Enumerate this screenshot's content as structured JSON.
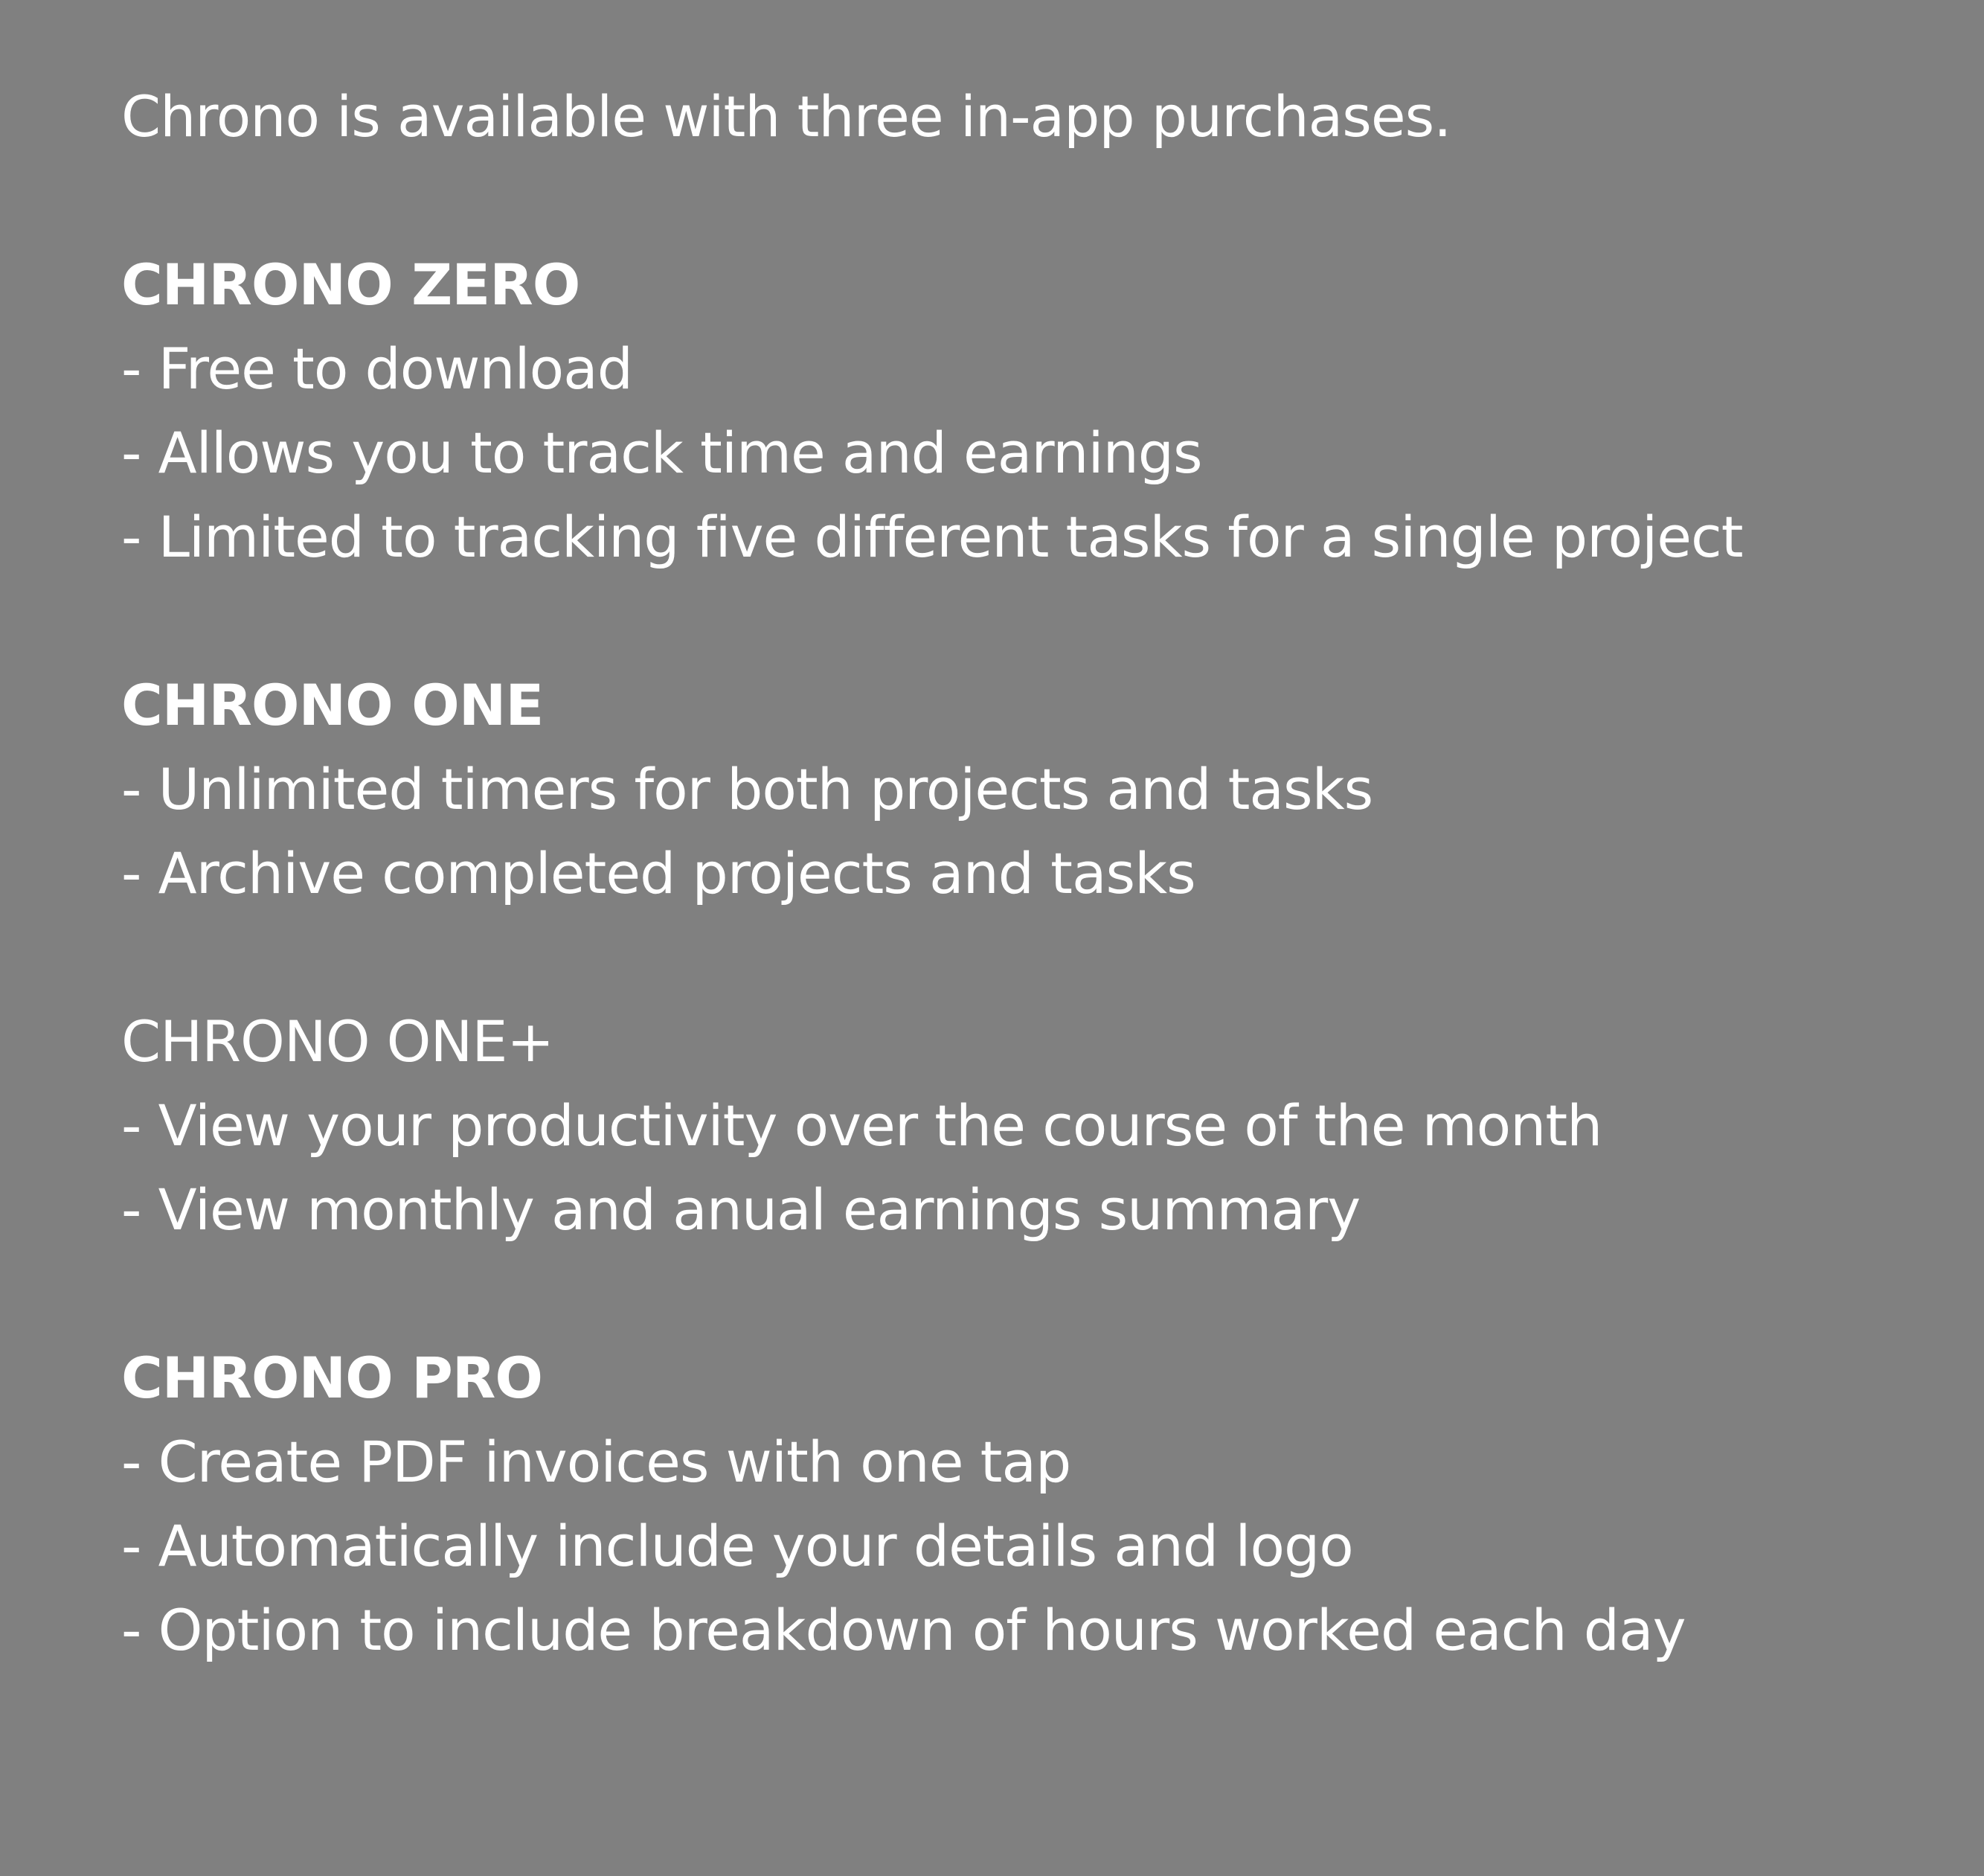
{
  "intro": "Chrono is available with three in-app purchases.",
  "sections": [
    {
      "title": "CHRONO ZERO",
      "items": [
        "- Free to download",
        "- Allows you to track time and earnings",
        "- Limited to tracking five different tasks for a single project"
      ]
    },
    {
      "title": "CHRONO ONE",
      "items": [
        "- Unlimited timers for both projects and tasks",
        "- Archive completed projects and tasks"
      ]
    },
    {
      "title": "CHRONO ONE+",
      "items": [
        "- View your productivity over the course of the month",
        "- View monthly and anual earnings summary"
      ]
    },
    {
      "title": "CHRONO PRO",
      "items": [
        "- Create PDF invoices with one tap",
        "- Automatically include your details and logo",
        "- Option to include breakdown of hours worked each day"
      ]
    }
  ],
  "colors": {
    "background": "#808080",
    "text": "#ffffff"
  }
}
